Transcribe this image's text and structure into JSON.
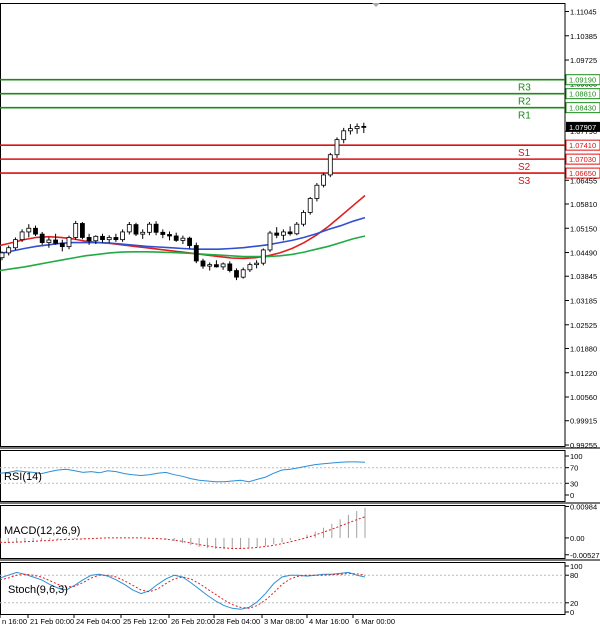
{
  "chart_data": [
    {
      "type": "candlestick",
      "title": "",
      "price_axis": {
        "ticks": [
          "1.11045",
          "1.10385",
          "1.09725",
          "1.09085",
          "1.07790",
          "1.06455",
          "1.05810",
          "1.05150",
          "1.04490",
          "1.03845",
          "1.03185",
          "1.02525",
          "1.01880",
          "1.01220",
          "1.00560",
          "0.99915",
          "0.99255"
        ],
        "ylim": [
          0.99255,
          1.11045
        ]
      },
      "pivot_levels": [
        {
          "name": "R3",
          "value": "1.09190",
          "color": "#1a8a1a"
        },
        {
          "name": "R2",
          "value": "1.08810",
          "color": "#1a8a1a"
        },
        {
          "name": "R1",
          "value": "1.08430",
          "color": "#1a8a1a"
        },
        {
          "name": "S1",
          "value": "1.07410",
          "color": "#dd1111"
        },
        {
          "name": "S2",
          "value": "1.07030",
          "color": "#dd1111"
        },
        {
          "name": "S3",
          "value": "1.06650",
          "color": "#dd1111"
        }
      ],
      "current_price": {
        "value": "1.07907"
      },
      "time_axis": [
        "n 16:00",
        "21 Feb 00:00",
        "24 Feb 04:00",
        "25 Feb 12:00",
        "26 Feb 20:00",
        "28 Feb 04:00",
        "3 Mar 08:00",
        "4 Mar 16:00",
        "6 Mar 00:00"
      ],
      "candles": [
        [
          1.0435,
          1.0452,
          1.0428,
          1.0448
        ],
        [
          1.0448,
          1.0468,
          1.0441,
          1.0462
        ],
        [
          1.0462,
          1.049,
          1.0456,
          1.0484
        ],
        [
          1.0484,
          1.0512,
          1.0478,
          1.0505
        ],
        [
          1.0505,
          1.0526,
          1.049,
          1.0515
        ],
        [
          1.0515,
          1.0522,
          1.0494,
          1.0499
        ],
        [
          1.0499,
          1.0505,
          1.047,
          1.0476
        ],
        [
          1.0476,
          1.049,
          1.0462,
          1.0483
        ],
        [
          1.0483,
          1.05,
          1.047,
          1.0474
        ],
        [
          1.0474,
          1.0484,
          1.0452,
          1.0465
        ],
        [
          1.0465,
          1.0495,
          1.0458,
          1.049
        ],
        [
          1.049,
          1.0535,
          1.0484,
          1.0528
        ],
        [
          1.0528,
          1.0532,
          1.0485,
          1.049
        ],
        [
          1.049,
          1.05,
          1.047,
          1.0481
        ],
        [
          1.0481,
          1.0496,
          1.0472,
          1.0493
        ],
        [
          1.0493,
          1.05,
          1.0476,
          1.0484
        ],
        [
          1.0484,
          1.0496,
          1.0475,
          1.049
        ],
        [
          1.049,
          1.05,
          1.0478,
          1.0484
        ],
        [
          1.0484,
          1.0512,
          1.0478,
          1.0505
        ],
        [
          1.0505,
          1.0532,
          1.0498,
          1.0525
        ],
        [
          1.0525,
          1.053,
          1.0494,
          1.0499
        ],
        [
          1.0499,
          1.0512,
          1.0486,
          1.0504
        ],
        [
          1.0504,
          1.0532,
          1.0496,
          1.0526
        ],
        [
          1.0526,
          1.0534,
          1.0496,
          1.0504
        ],
        [
          1.0504,
          1.0512,
          1.0488,
          1.0498
        ],
        [
          1.0498,
          1.0506,
          1.0482,
          1.0494
        ],
        [
          1.0494,
          1.0503,
          1.0478,
          1.0482
        ],
        [
          1.0482,
          1.0495,
          1.0472,
          1.0488
        ],
        [
          1.0488,
          1.0492,
          1.046,
          1.0468
        ],
        [
          1.0468,
          1.0476,
          1.042,
          1.0426
        ],
        [
          1.0426,
          1.0432,
          1.0405,
          1.0412
        ],
        [
          1.0412,
          1.0422,
          1.04,
          1.0416
        ],
        [
          1.0416,
          1.0428,
          1.0408,
          1.041
        ],
        [
          1.041,
          1.0422,
          1.0402,
          1.0418
        ],
        [
          1.0418,
          1.0425,
          1.0395,
          1.04
        ],
        [
          1.04,
          1.0406,
          1.0374,
          1.0382
        ],
        [
          1.0382,
          1.0408,
          1.0378,
          1.0402
        ],
        [
          1.0402,
          1.0422,
          1.0396,
          1.0416
        ],
        [
          1.0416,
          1.0428,
          1.0406,
          1.042
        ],
        [
          1.042,
          1.046,
          1.0414,
          1.0456
        ],
        [
          1.0456,
          1.0508,
          1.045,
          1.0502
        ],
        [
          1.0502,
          1.0518,
          1.0488,
          1.0496
        ],
        [
          1.0496,
          1.0512,
          1.0482,
          1.0505
        ],
        [
          1.0505,
          1.052,
          1.0495,
          1.05
        ],
        [
          1.05,
          1.0532,
          1.0496,
          1.0526
        ],
        [
          1.0526,
          1.0564,
          1.052,
          1.0558
        ],
        [
          1.0558,
          1.06,
          1.0552,
          1.0596
        ],
        [
          1.0596,
          1.0638,
          1.0588,
          1.0632
        ],
        [
          1.0632,
          1.0666,
          1.0626,
          1.066
        ],
        [
          1.066,
          1.072,
          1.0654,
          1.0715
        ],
        [
          1.0715,
          1.0762,
          1.0706,
          1.0756
        ],
        [
          1.0756,
          1.0788,
          1.0746,
          1.078
        ],
        [
          1.078,
          1.0798,
          1.077,
          1.0786
        ],
        [
          1.0786,
          1.08,
          1.0772,
          1.0792
        ],
        [
          1.0792,
          1.0802,
          1.0774,
          1.079
        ]
      ],
      "moving_averages": [
        {
          "color": "#e02020",
          "values": [
            1.0468,
            1.0476,
            1.0484,
            1.049,
            1.0492,
            1.049,
            1.0486,
            1.048,
            1.0476,
            1.0474,
            1.047,
            1.0466,
            1.0462,
            1.0458,
            1.0454,
            1.045,
            1.0446,
            1.0442,
            1.0438,
            1.0434,
            1.0433,
            1.0435,
            1.044,
            1.0448,
            1.046,
            1.0476,
            1.0496,
            1.052,
            1.0548,
            1.0576,
            1.0604
          ]
        },
        {
          "color": "#3050d0",
          "values": [
            1.0446,
            1.0453,
            1.046,
            1.0466,
            1.047,
            1.0474,
            1.0476,
            1.0476,
            1.0476,
            1.0475,
            1.0472,
            1.0469,
            1.0466,
            1.0464,
            1.0462,
            1.046,
            1.0458,
            1.0458,
            1.0458,
            1.046,
            1.0462,
            1.0466,
            1.047,
            1.0476,
            1.0482,
            1.049,
            1.05,
            1.0512,
            1.0522,
            1.0534,
            1.0544
          ]
        },
        {
          "color": "#22aa44",
          "values": [
            1.04,
            1.0405,
            1.041,
            1.0416,
            1.0422,
            1.0428,
            1.0434,
            1.044,
            1.0444,
            1.0448,
            1.045,
            1.0451,
            1.0451,
            1.045,
            1.0449,
            1.0448,
            1.0446,
            1.0444,
            1.0442,
            1.044,
            1.0438,
            1.0438,
            1.0438,
            1.044,
            1.0444,
            1.045,
            1.0458,
            1.0466,
            1.0476,
            1.0486,
            1.0494
          ]
        }
      ]
    },
    {
      "type": "line",
      "indicator": "RSI(14)",
      "label": "RSI(14)",
      "ticks": [
        "100",
        "70",
        "30",
        "0"
      ],
      "ylim": [
        0,
        100
      ],
      "values": [
        56,
        58,
        62,
        60,
        58,
        55,
        60,
        64,
        66,
        62,
        58,
        60,
        57,
        62,
        60,
        55,
        52,
        50,
        52,
        56,
        58,
        52,
        48,
        42,
        38,
        36,
        34,
        34,
        36,
        38,
        34,
        40,
        46,
        56,
        64,
        66,
        70,
        74,
        78,
        80,
        82,
        84,
        85,
        85,
        84
      ]
    },
    {
      "type": "bar",
      "indicator": "MACD(12,26,9)",
      "label": "MACD(12,26,9)",
      "ticks": [
        "0.00984",
        "0.00",
        "-0.005271"
      ],
      "ylim": [
        -0.00628,
        0.01029
      ],
      "histogram": [
        -0.0018,
        -0.0016,
        -0.0014,
        -0.0012,
        -0.001,
        -0.0008,
        -0.0006,
        -0.0005,
        -0.0004,
        -0.0003,
        -0.0002,
        -0.0001,
        0.0,
        0.0001,
        0.0001,
        0.0002,
        0.0001,
        0.0,
        0.0,
        -0.0002,
        -0.0005,
        -0.001,
        -0.0016,
        -0.0022,
        -0.0028,
        -0.0032,
        -0.0034,
        -0.0035,
        -0.0035,
        -0.0034,
        -0.0032,
        -0.0029,
        -0.0025,
        -0.002,
        -0.0014,
        -0.0007,
        0.0001,
        0.001,
        0.002,
        0.0032,
        0.0044,
        0.0058,
        0.0072,
        0.0084,
        0.0094
      ],
      "signal": [
        -0.0014,
        -0.0014,
        -0.0013,
        -0.0012,
        -0.0011,
        -0.0009,
        -0.0008,
        -0.0006,
        -0.0005,
        -0.0004,
        -0.0003,
        -0.0002,
        -0.0001,
        0.0,
        0.0,
        0.0,
        0.0,
        0.0,
        -0.0001,
        -0.0002,
        -0.0004,
        -0.0007,
        -0.0011,
        -0.0016,
        -0.0021,
        -0.0025,
        -0.0029,
        -0.0031,
        -0.0033,
        -0.0033,
        -0.0032,
        -0.003,
        -0.0027,
        -0.0023,
        -0.0018,
        -0.0012,
        -0.0006,
        0.0001,
        0.0009,
        0.0018,
        0.0027,
        0.0037,
        0.0047,
        0.0057,
        0.0066
      ]
    },
    {
      "type": "line",
      "indicator": "Stoch(9,6,3)",
      "label": "Stoch(9,6,3)",
      "ticks": [
        "100",
        "80",
        "20",
        "0"
      ],
      "ylim": [
        0,
        100
      ],
      "main": [
        74,
        80,
        86,
        82,
        76,
        70,
        60,
        52,
        48,
        58,
        70,
        80,
        82,
        78,
        70,
        60,
        48,
        40,
        46,
        60,
        72,
        80,
        76,
        64,
        50,
        36,
        24,
        14,
        8,
        6,
        10,
        22,
        40,
        62,
        76,
        80,
        80,
        78,
        80,
        82,
        82,
        84,
        86,
        80,
        76
      ],
      "signal": [
        70,
        74,
        80,
        82,
        80,
        76,
        68,
        60,
        54,
        56,
        64,
        74,
        80,
        80,
        76,
        68,
        58,
        48,
        44,
        50,
        62,
        72,
        76,
        72,
        62,
        50,
        38,
        26,
        16,
        10,
        8,
        14,
        26,
        42,
        60,
        72,
        78,
        80,
        80,
        80,
        81,
        82,
        84,
        83,
        80
      ]
    }
  ]
}
